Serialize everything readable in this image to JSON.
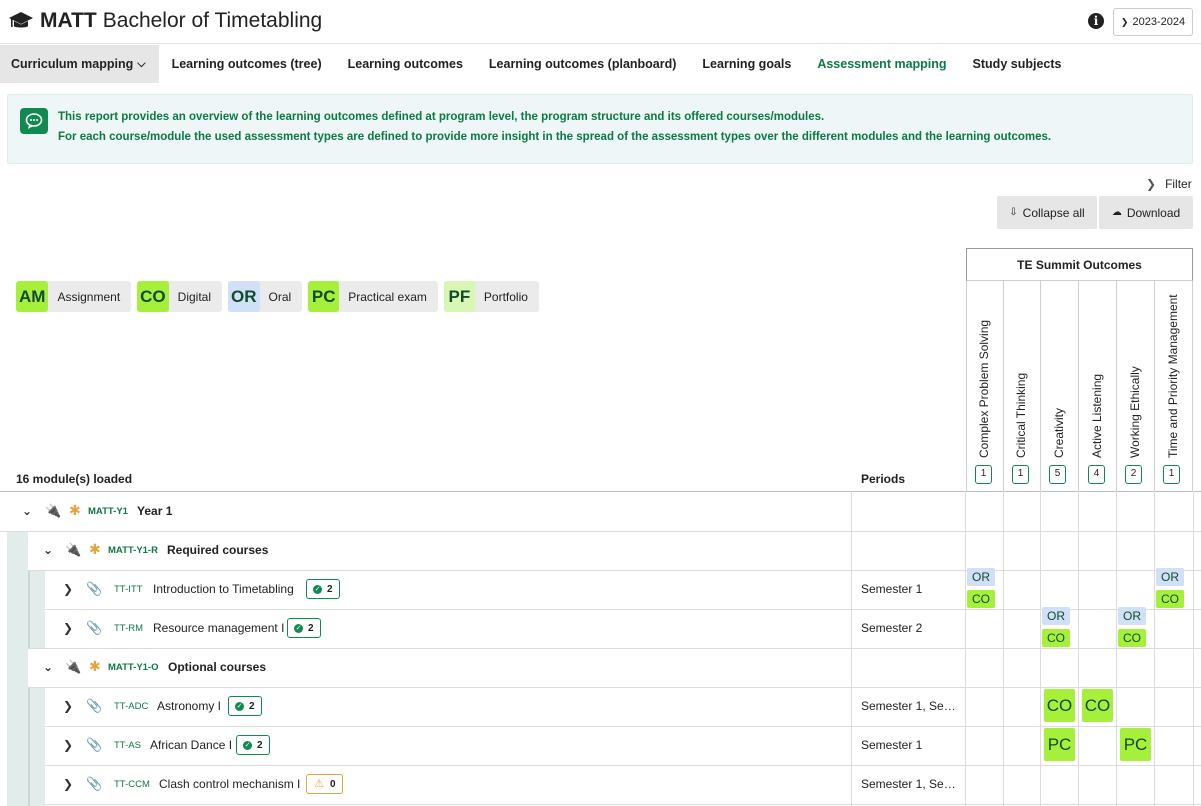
{
  "header": {
    "brand": "MATT",
    "title": "Bachelor of Timetabling",
    "year": "2023-2024"
  },
  "tabs": [
    {
      "label": "Curriculum mapping"
    },
    {
      "label": "Learning outcomes (tree)"
    },
    {
      "label": "Learning outcomes"
    },
    {
      "label": "Learning outcomes (planboard)"
    },
    {
      "label": "Learning goals"
    },
    {
      "label": "Assessment mapping"
    },
    {
      "label": "Study subjects"
    }
  ],
  "info": {
    "line1": "This report provides an overview of the learning outcomes defined at program level, the program structure and its offered courses/modules.",
    "line2": "For each course/module the used assessment types are defined to provide more insight in the spread of the assessment types over the different modules and the learning outcomes."
  },
  "toolbar": {
    "filter": "Filter",
    "collapse": "Collapse all",
    "download": "Download"
  },
  "legend": [
    {
      "code": "AM",
      "label": "Assignment",
      "color": "#a6f03b"
    },
    {
      "code": "CO",
      "label": "Digital",
      "color": "#a6f03b"
    },
    {
      "code": "OR",
      "label": "Oral",
      "color": "#cfe0f7"
    },
    {
      "code": "PC",
      "label": "Practical exam",
      "color": "#a6f03b"
    },
    {
      "code": "PF",
      "label": "Portfolio",
      "color": "#d8f7b4"
    }
  ],
  "outcomes": {
    "title": "TE Summit Outcomes",
    "columns": [
      {
        "name": "Complex Problem Solving",
        "count": "1"
      },
      {
        "name": "Critical Thinking",
        "count": "1"
      },
      {
        "name": "Creativity",
        "count": "5"
      },
      {
        "name": "Active Listening",
        "count": "4"
      },
      {
        "name": "Working Ethically",
        "count": "2"
      },
      {
        "name": "Time and Priority Management",
        "count": "1"
      }
    ]
  },
  "table": {
    "loaded": "16 module(s) loaded",
    "periods_header": "Periods",
    "rows": [
      {
        "code": "MATT-Y1",
        "name": "Year 1"
      },
      {
        "code": "MATT-Y1-R",
        "name": "Required courses"
      },
      {
        "code": "TT-ITT",
        "name": "Introduction to Timetabling",
        "badge": "2",
        "period": "Semester 1"
      },
      {
        "code": "TT-RM",
        "name": "Resource management I",
        "badge": "2",
        "period": "Semester 2"
      },
      {
        "code": "MATT-Y1-O",
        "name": "Optional courses"
      },
      {
        "code": "TT-ADC",
        "name": "Astronomy I",
        "badge": "2",
        "period": "Semester 1, Se…"
      },
      {
        "code": "TT-AS",
        "name": "African Dance I",
        "badge": "2",
        "period": "Semester 1"
      },
      {
        "code": "TT-CCM",
        "name": "Clash control mechanism I",
        "badge": "0",
        "period": "Semester 1, Se…"
      }
    ],
    "chips": {
      "or": "OR",
      "co": "CO",
      "pc": "PC"
    }
  },
  "colors": {
    "accent": "#0b7a43",
    "digital": "#a6f03b",
    "oral": "#cfe0f7",
    "warning": "#e8a33b"
  }
}
